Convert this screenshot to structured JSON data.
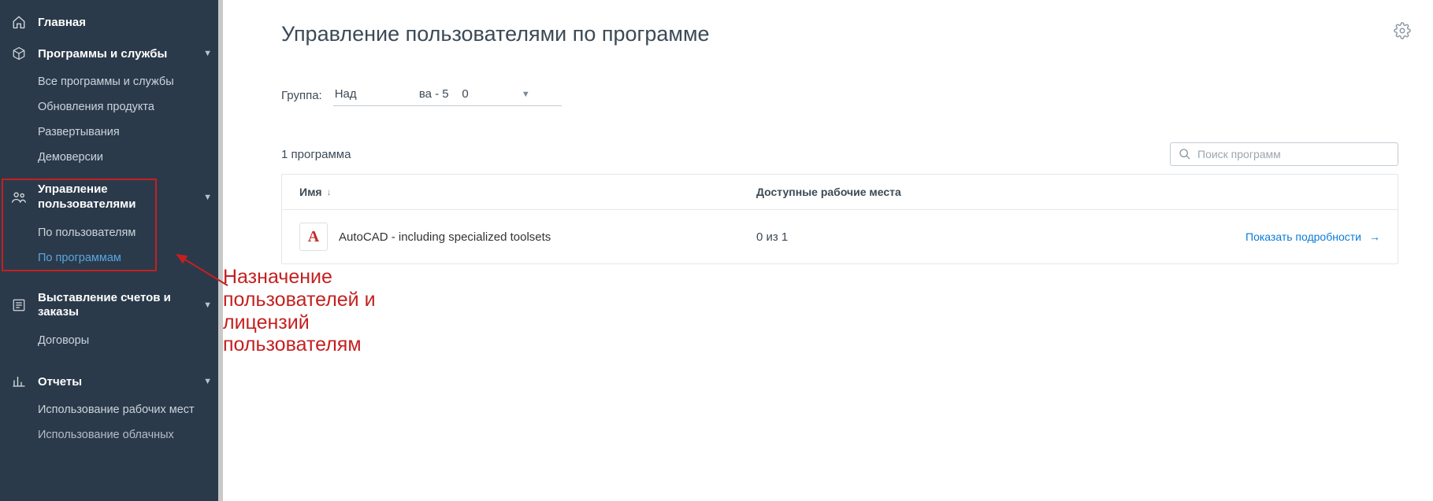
{
  "sidebar": {
    "home": "Главная",
    "programs": {
      "label": "Программы и службы",
      "items": [
        "Все программы и службы",
        "Обновления продукта",
        "Развертывания",
        "Демоверсии"
      ]
    },
    "users": {
      "label": "Управление пользователями",
      "items": [
        "По пользователям",
        "По программам"
      ]
    },
    "billing": {
      "label": "Выставление счетов и заказы",
      "items": [
        "Договоры"
      ]
    },
    "reports": {
      "label": "Отчеты",
      "items": [
        "Использование рабочих мест",
        "Использование облачных"
      ]
    }
  },
  "main": {
    "title": "Управление пользователями по программе",
    "group_label": "Группа:",
    "group_value": "Над                   ва - 5    0",
    "count": "1 программа",
    "search_placeholder": "Поиск программ",
    "col_name": "Имя",
    "col_seats": "Доступные рабочие места",
    "row": {
      "icon_letter": "A",
      "name": "AutoCAD - including specialized toolsets",
      "seats": "0 из 1",
      "details": "Показать подробности"
    }
  },
  "annotation": "Назначение\nпользователей и\nлицензий\nпользователям"
}
